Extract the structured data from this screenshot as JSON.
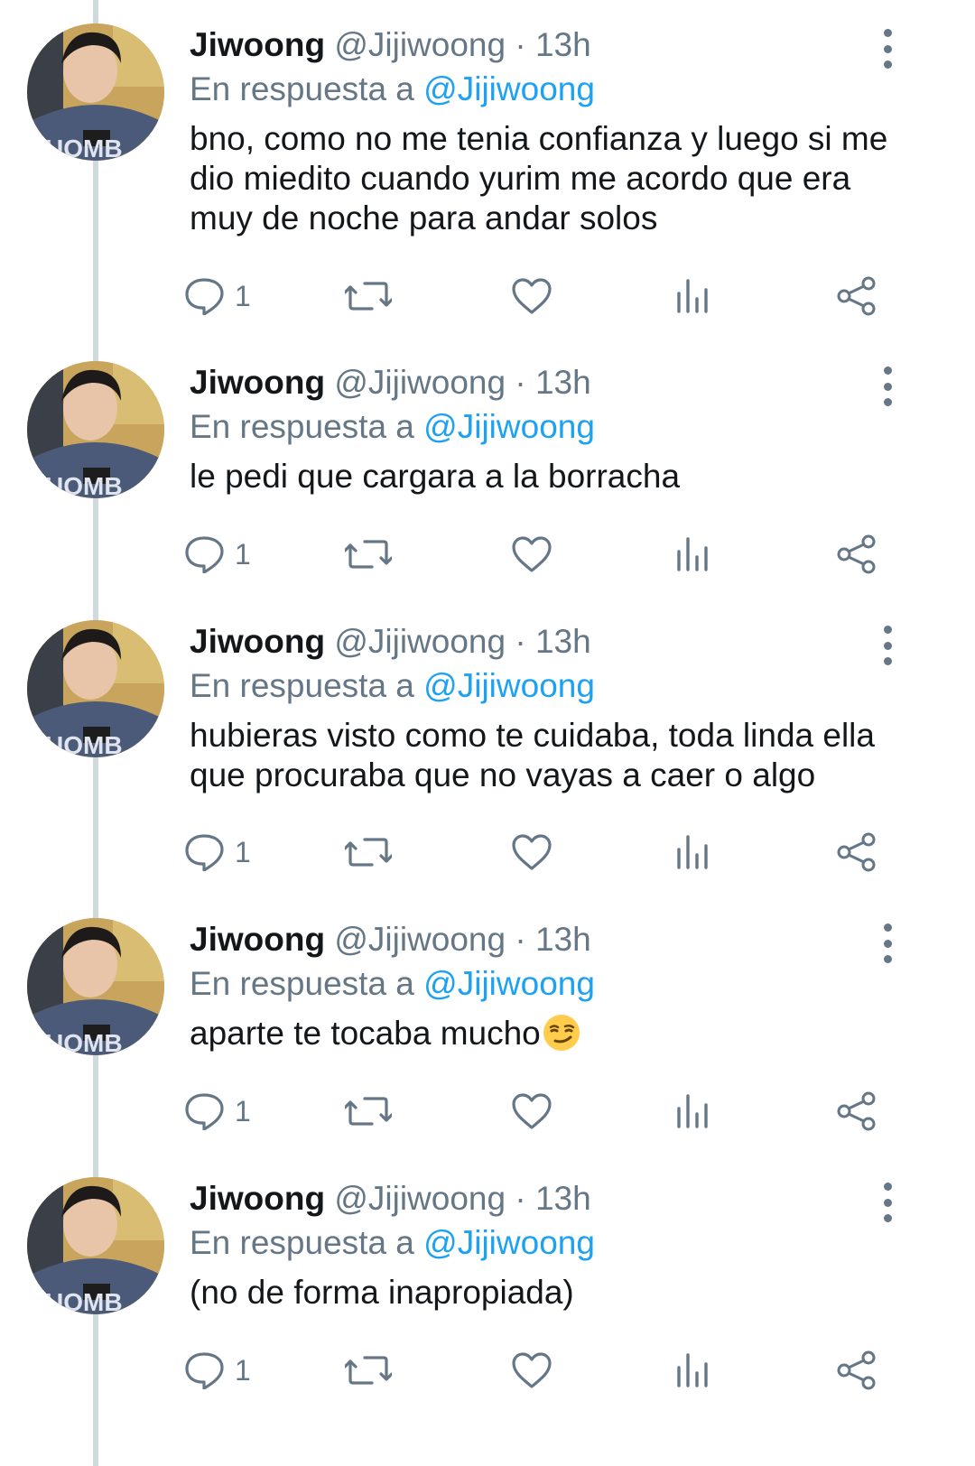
{
  "colors": {
    "text": "#14171a",
    "secondary": "#657786",
    "mention": "#1da1f2",
    "thread_line": "#cfd9de"
  },
  "icons": {
    "reply": "reply-icon",
    "retweet": "retweet-icon",
    "like": "heart-icon",
    "analytics": "analytics-icon",
    "share": "share-icon",
    "more": "more-vertical-icon",
    "emoji": "smirking-face-emoji"
  },
  "tweets": [
    {
      "name": "Jiwoong",
      "handle": "@Jijiwoong",
      "separator": "·",
      "time": "13h",
      "reply_prefix": "En respuesta a",
      "reply_to": "@Jijiwoong",
      "text": "bno, como no me tenia confianza y luego si me\ndio miedito cuando yurim me acordo que era\nmuy de noche para andar solos",
      "reply_count": "1"
    },
    {
      "name": "Jiwoong",
      "handle": "@Jijiwoong",
      "separator": "·",
      "time": "13h",
      "reply_prefix": "En respuesta a",
      "reply_to": "@Jijiwoong",
      "text": "le pedi que cargara a la borracha",
      "reply_count": "1"
    },
    {
      "name": "Jiwoong",
      "handle": "@Jijiwoong",
      "separator": "·",
      "time": "13h",
      "reply_prefix": "En respuesta a",
      "reply_to": "@Jijiwoong",
      "text": "hubieras visto como te cuidaba, toda linda ella\nque procuraba que no vayas a caer o algo",
      "reply_count": "1"
    },
    {
      "name": "Jiwoong",
      "handle": "@Jijiwoong",
      "separator": "·",
      "time": "13h",
      "reply_prefix": "En respuesta a",
      "reply_to": "@Jijiwoong",
      "text": "aparte te tocaba mucho",
      "emoji": "😏",
      "reply_count": "1"
    },
    {
      "name": "Jiwoong",
      "handle": "@Jijiwoong",
      "separator": "·",
      "time": "13h",
      "reply_prefix": "En respuesta a",
      "reply_to": "@Jijiwoong",
      "text": "(no de forma inapropiada)",
      "reply_count": "1"
    }
  ]
}
